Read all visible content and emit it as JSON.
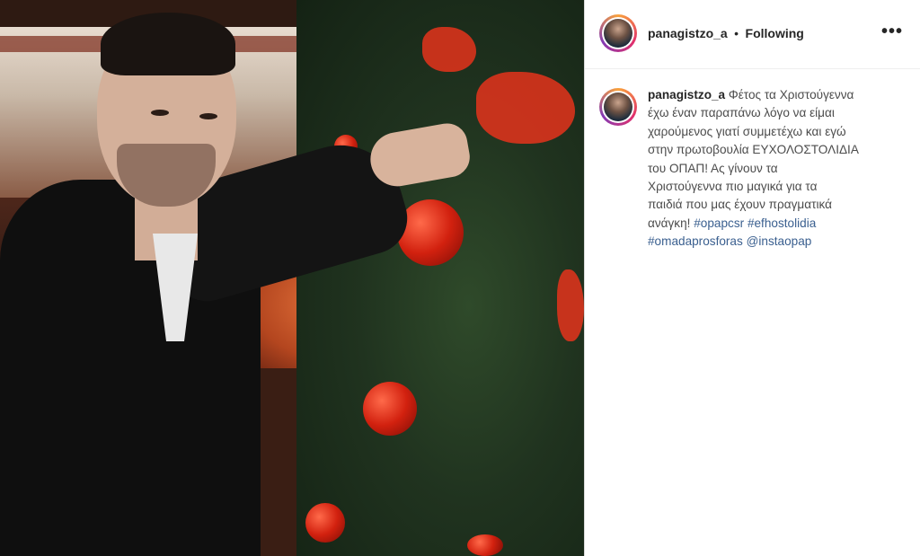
{
  "post": {
    "username": "panagistzo_a",
    "separator": "•",
    "follow_status": "Following",
    "more_options": "•••",
    "caption_lines": [
      "Φέτος τα Χριστούγεννα",
      "έχω έναν παραπάνω λόγο να είμαι",
      "χαρούμενος γιατί συμμετέχω και εγώ",
      "στην πρωτοβουλία ΕΥΧΟΛΟΣΤΟΛΙΔΙΑ",
      "του ΟΠΑΠ! Ας γίνουν τα",
      "Χριστούγεννα πιο μαγικά για τα",
      "παιδιά που μας έχουν πραγματικά",
      "ανάγκη!"
    ],
    "hashtags": {
      "tag1": "#opapcsr",
      "tag2": "#efhostolidia",
      "tag3": "#omadaprosforas",
      "mention": "@instaopap"
    }
  },
  "icons": {
    "avatar": "profile-avatar",
    "more": "more-options-icon"
  },
  "colors": {
    "link": "#3a5f8f",
    "text": "#262626",
    "story_ring": [
      "#f9a23b",
      "#e1306c",
      "#833ab4"
    ]
  }
}
